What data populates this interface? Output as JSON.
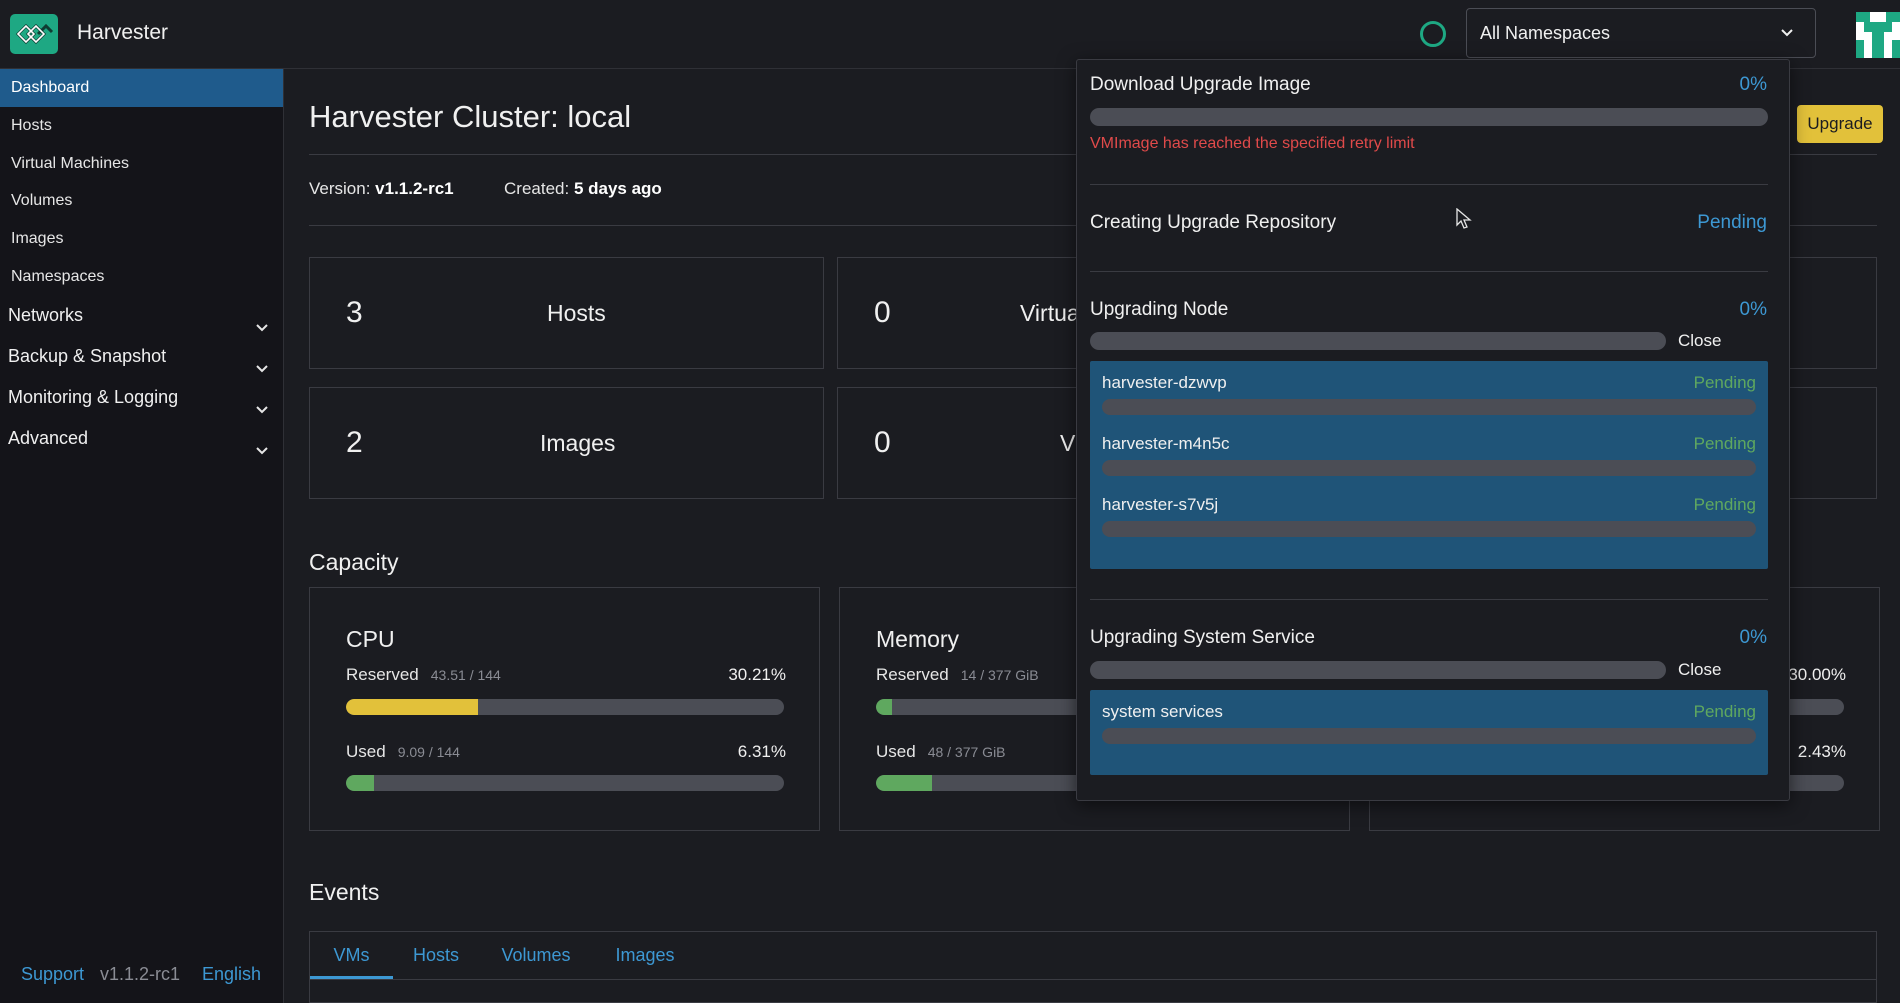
{
  "header": {
    "app_title": "Harvester",
    "logo_icon": "harvester-logo-icon",
    "namespace_select": "All Namespaces"
  },
  "sidebar": {
    "items": [
      {
        "label": "Dashboard",
        "active": true
      },
      {
        "label": "Hosts"
      },
      {
        "label": "Virtual Machines"
      },
      {
        "label": "Volumes"
      },
      {
        "label": "Images"
      },
      {
        "label": "Namespaces"
      }
    ],
    "groups": [
      {
        "label": "Networks"
      },
      {
        "label": "Backup & Snapshot"
      },
      {
        "label": "Monitoring & Logging"
      },
      {
        "label": "Advanced"
      }
    ],
    "footer": {
      "support": "Support",
      "version": "v1.1.2-rc1",
      "language": "English"
    }
  },
  "main": {
    "title": "Harvester Cluster: local",
    "upgrade_button": "Upgrade",
    "version_label": "Version:",
    "version_value": "v1.1.2-rc1",
    "created_label": "Created:",
    "created_value": "5 days ago",
    "stats": [
      {
        "count": "3",
        "label": "Hosts"
      },
      {
        "count": "0",
        "label": "Virtua"
      },
      {
        "count": "2",
        "label": "Images"
      },
      {
        "count": "0",
        "label": "V"
      }
    ],
    "capacity_title": "Capacity",
    "capacity": {
      "cpu": {
        "title": "CPU",
        "reserved_label": "Reserved",
        "reserved_detail": "43.51 / 144",
        "reserved_pct": "30.21%",
        "reserved_fraction": 0.3021,
        "used_label": "Used",
        "used_detail": "9.09 / 144",
        "used_pct": "6.31%",
        "used_fraction": 0.0631
      },
      "memory": {
        "title": "Memory",
        "reserved_label": "Reserved",
        "reserved_detail": "14 / 377 GiB",
        "reserved_fraction": 0.037,
        "used_label": "Used",
        "used_detail": "48 / 377 GiB",
        "used_fraction": 0.127
      },
      "storage_partial": {
        "reserved_pct": "30.00%",
        "used_pct": "2.43%"
      }
    },
    "events_title": "Events",
    "event_tabs": [
      "VMs",
      "Hosts",
      "Volumes",
      "Images"
    ]
  },
  "upgrade_popover": {
    "download": {
      "title": "Download Upgrade Image",
      "value": "0%",
      "error": "VMImage has reached the specified retry limit"
    },
    "repository": {
      "title": "Creating Upgrade Repository",
      "value": "Pending"
    },
    "nodes": {
      "title": "Upgrading Node",
      "value": "0%",
      "close": "Close",
      "items": [
        {
          "name": "harvester-dzwvp",
          "state": "Pending"
        },
        {
          "name": "harvester-m4n5c",
          "state": "Pending"
        },
        {
          "name": "harvester-s7v5j",
          "state": "Pending"
        }
      ]
    },
    "system": {
      "title": "Upgrading System Service",
      "value": "0%",
      "close": "Close",
      "items": [
        {
          "name": "system services",
          "state": "Pending"
        }
      ]
    }
  },
  "colors": {
    "accent": "#3d98d3",
    "brand": "#1ea883",
    "reserved_fill": "#e2c13a",
    "used_fill": "#5fa85f",
    "active_nav": "#1f5b8c",
    "error": "#e04a4a"
  }
}
